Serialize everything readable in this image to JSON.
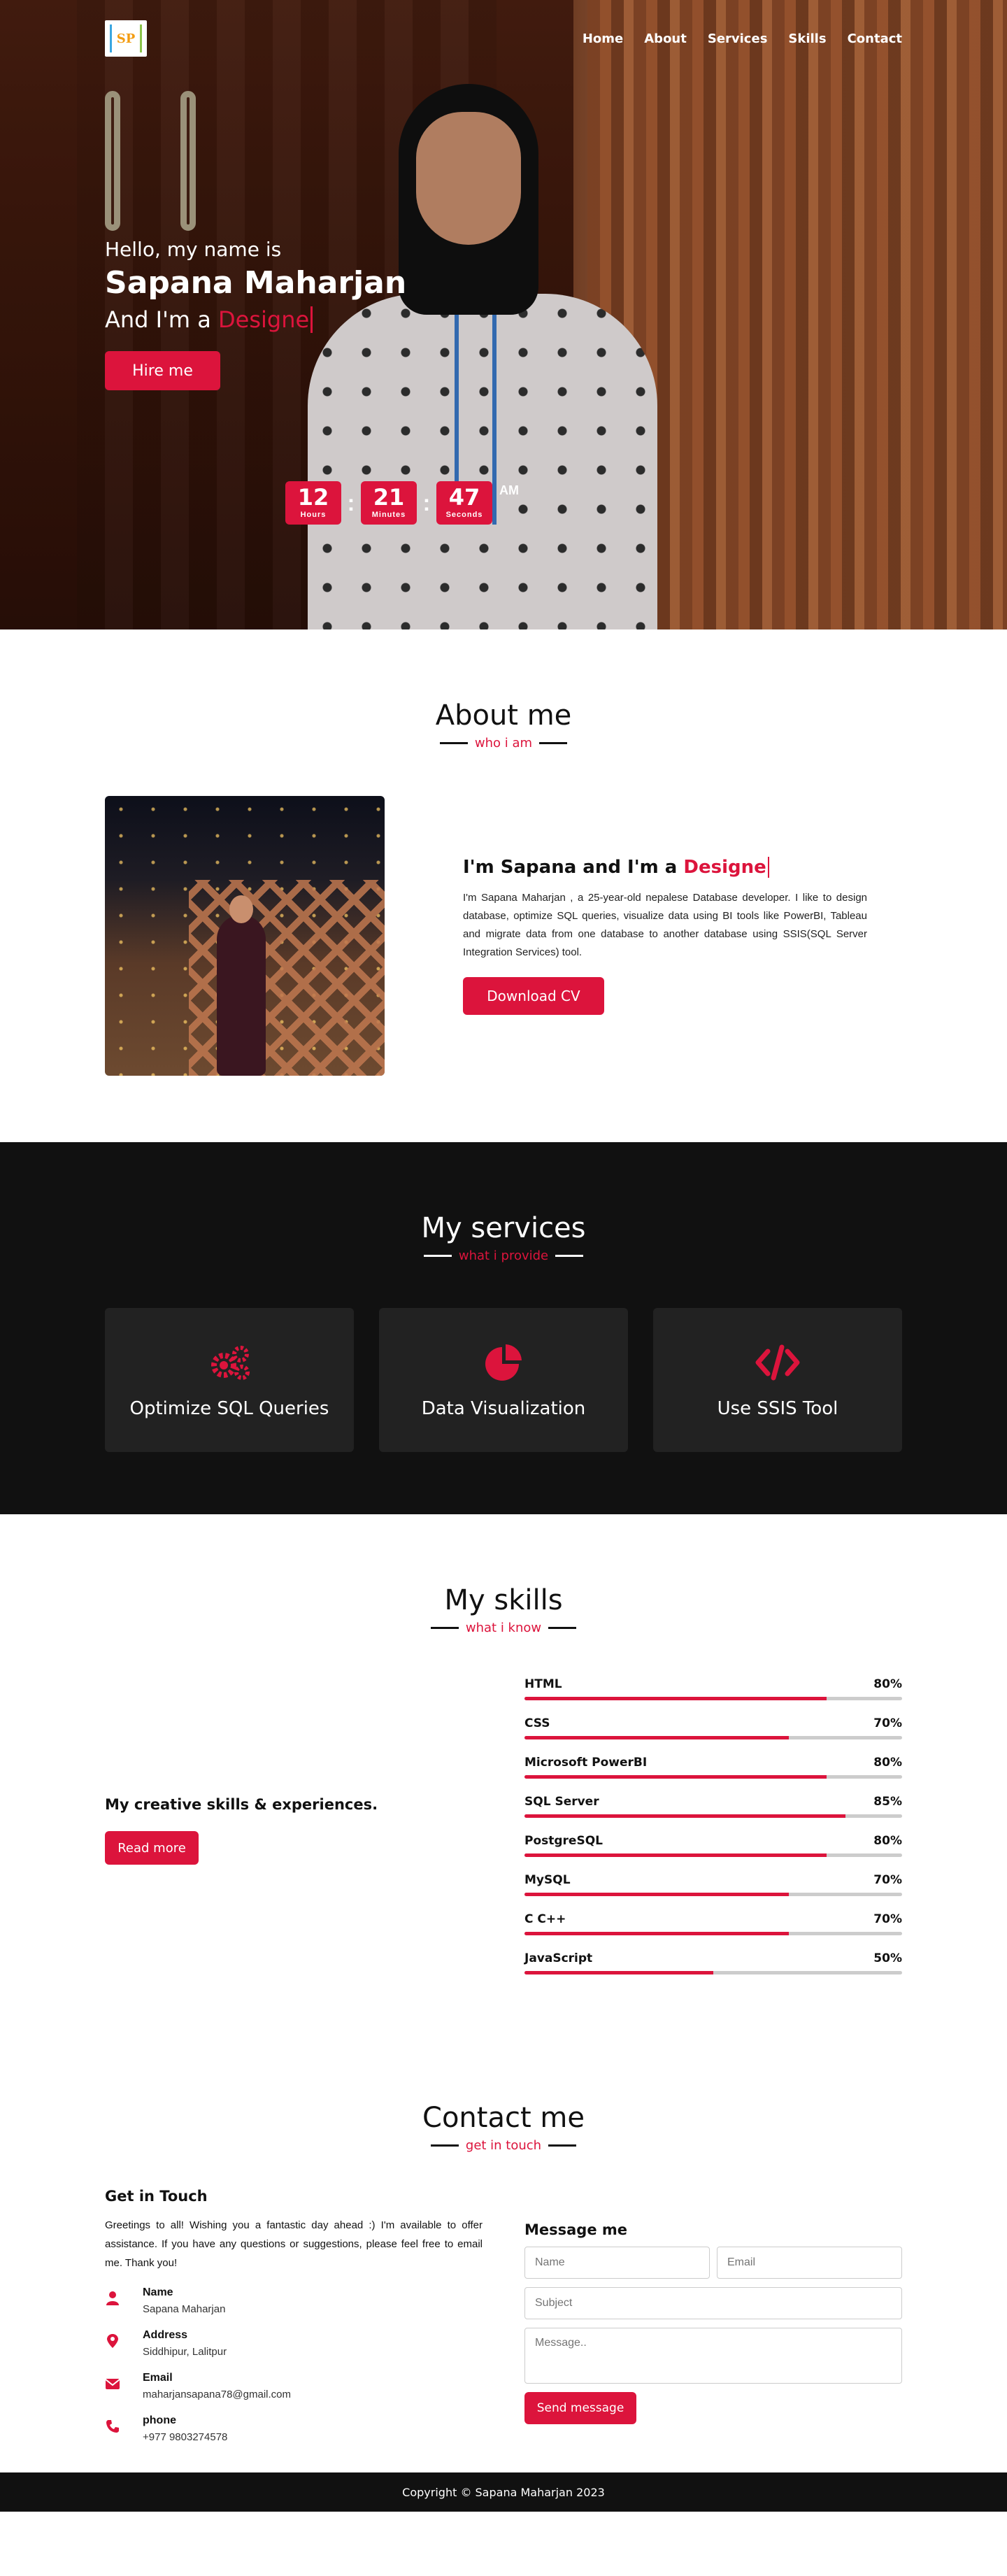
{
  "nav": {
    "logo_text": "SP",
    "links": [
      "Home",
      "About",
      "Services",
      "Skills",
      "Contact"
    ]
  },
  "hero": {
    "greeting": "Hello, my name is",
    "name": "Sapana Maharjan",
    "role_prefix": "And I'm a",
    "role_typed": "Designe",
    "button": "Hire me"
  },
  "clock": {
    "hours": "12",
    "hours_label": "Hours",
    "minutes": "21",
    "minutes_label": "Minutes",
    "seconds": "47",
    "seconds_label": "Seconds",
    "sep": ":",
    "period": "AM"
  },
  "about": {
    "title": "About me",
    "subtitle": "who i am",
    "heading_prefix": "I'm Sapana and I'm a",
    "heading_typed": "Designe",
    "text": "I'm Sapana Maharjan , a 25-year-old nepalese Database developer. I like to design database, optimize SQL queries, visualize data using BI tools like PowerBI, Tableau and migrate data from one database to another database using SSIS(SQL Server Integration Services) tool.",
    "button": "Download CV"
  },
  "services": {
    "title": "My services",
    "subtitle": "what i provide",
    "items": [
      {
        "icon": "gears-icon",
        "title": "Optimize SQL Queries"
      },
      {
        "icon": "pie-chart-icon",
        "title": "Data Visualization"
      },
      {
        "icon": "code-icon",
        "title": "Use SSIS Tool"
      }
    ]
  },
  "skills": {
    "title": "My skills",
    "subtitle": "what i know",
    "heading": "My creative skills & experiences.",
    "button": "Read more",
    "list": [
      {
        "name": "HTML",
        "percent": "80%",
        "value": 80
      },
      {
        "name": "CSS",
        "percent": "70%",
        "value": 70
      },
      {
        "name": "Microsoft PowerBI",
        "percent": "80%",
        "value": 80
      },
      {
        "name": "SQL Server",
        "percent": "85%",
        "value": 85
      },
      {
        "name": "PostgreSQL",
        "percent": "80%",
        "value": 80
      },
      {
        "name": "MySQL",
        "percent": "70%",
        "value": 70
      },
      {
        "name": "C C++",
        "percent": "70%",
        "value": 70
      },
      {
        "name": "JavaScript",
        "percent": "50%",
        "value": 50
      }
    ]
  },
  "contact": {
    "title": "Contact me",
    "subtitle": "get in touch",
    "left_heading": "Get in Touch",
    "intro": "Greetings to all! Wishing you a fantastic day ahead :) I'm available to offer assistance. If you have any questions or suggestions, please feel free to email me. Thank you!",
    "info": [
      {
        "icon": "user-icon",
        "label": "Name",
        "value": "Sapana Maharjan"
      },
      {
        "icon": "map-marker-icon",
        "label": "Address",
        "value": "Siddhipur, Lalitpur"
      },
      {
        "icon": "envelope-icon",
        "label": "Email",
        "value": "maharjansapana78@gmail.com"
      },
      {
        "icon": "phone-icon",
        "label": "phone",
        "value": "+977 9803274578"
      }
    ],
    "form_heading": "Message me",
    "name_placeholder": "Name",
    "email_placeholder": "Email",
    "subject_placeholder": "Subject",
    "message_placeholder": "Message..",
    "send_button": "Send message"
  },
  "footer": {
    "text": "Copyright © Sapana Maharjan 2023"
  },
  "colors": {
    "accent": "#dc143c",
    "dark": "#111111",
    "card": "#222222"
  }
}
